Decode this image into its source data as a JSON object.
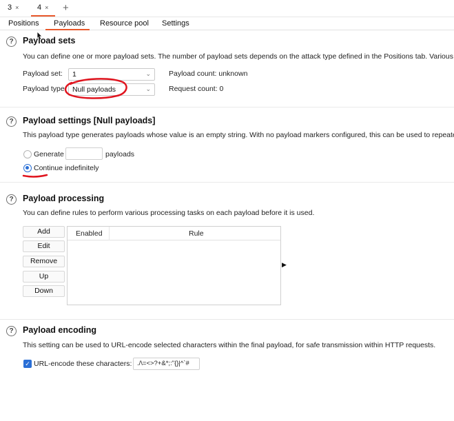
{
  "tabs": [
    {
      "label": "3",
      "close": "×"
    },
    {
      "label": "4",
      "close": "×"
    }
  ],
  "add_tab_glyph": "+",
  "subtabs": [
    "Positions",
    "Payloads",
    "Resource pool",
    "Settings"
  ],
  "help_glyph": "?",
  "payload_sets": {
    "title": "Payload sets",
    "description": "You can define one or more payload sets. The number of payload sets depends on the attack type defined in the Positions tab. Various pa",
    "set_label": "Payload set:",
    "set_value": "1",
    "type_label": "Payload type:",
    "type_value": "Null payloads",
    "payload_count": "Payload count:  unknown",
    "request_count": "Request count:  0"
  },
  "payload_settings": {
    "title": "Payload settings [Null payloads]",
    "description": "This payload type generates payloads whose value is an empty string. With no payload markers configured, this can be used to repeated",
    "generate_label": "Generate",
    "generate_value": "",
    "payloads_suffix": "payloads",
    "continue_label": "Continue indefinitely",
    "selected_option": "continue"
  },
  "payload_processing": {
    "title": "Payload processing",
    "description": "You can define rules to perform various processing tasks on each payload before it is used.",
    "buttons": [
      "Add",
      "Edit",
      "Remove",
      "Up",
      "Down"
    ],
    "columns": [
      "Enabled",
      "Rule"
    ],
    "expand_glyph": "▶"
  },
  "payload_encoding": {
    "title": "Payload encoding",
    "description": "This setting can be used to URL-encode selected characters within the final payload, for safe transmission within HTTP requests.",
    "checkbox_label": "URL-encode these characters:",
    "checked": true,
    "characters": "./\\=<>?+&*;:\"{}|^`#"
  },
  "colors": {
    "accent": "#e8572a",
    "annotation": "#e0141e",
    "selection": "#2a6fd6"
  }
}
